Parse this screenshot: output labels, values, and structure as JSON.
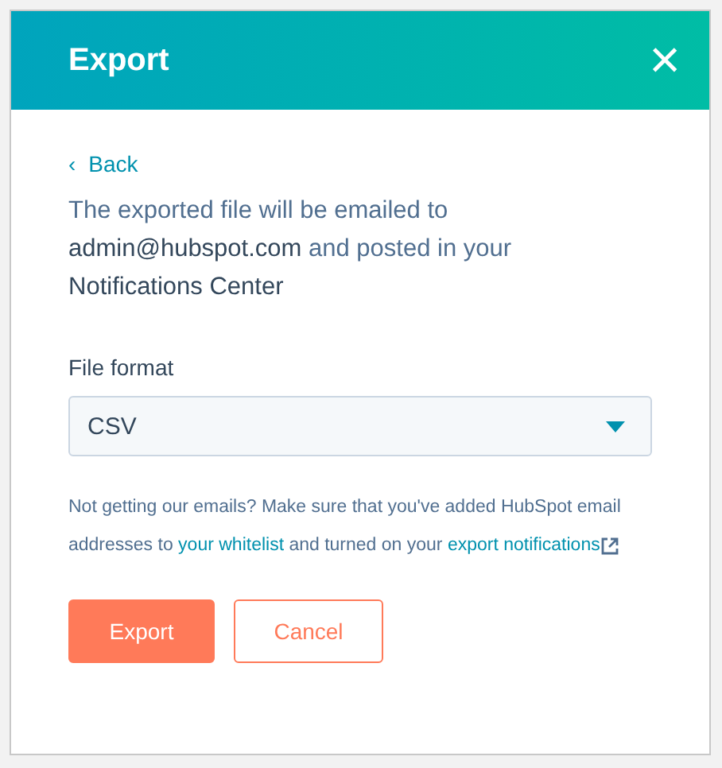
{
  "dialog": {
    "title": "Export",
    "close": "×"
  },
  "back": {
    "arrow": "‹",
    "label": "Back"
  },
  "message": "The exported file will be emailed to **admin@hubspot.com** and posted in your **Notifications Center**",
  "file_format": {
    "label": "File format",
    "value": "CSV"
  },
  "help": [
    {
      "kind": "text",
      "text": "Not getting our emails? Make sure that you've added HubSpot email addresses to "
    },
    {
      "kind": "link",
      "text": "your whitelist",
      "external": false
    },
    {
      "kind": "text",
      "text": " and turned on your "
    },
    {
      "kind": "link",
      "text": "export notifications",
      "external": true
    }
  ],
  "buttons": [
    {
      "kind": "primary",
      "label": "Export"
    },
    {
      "kind": "secondary",
      "label": "Cancel"
    }
  ]
}
